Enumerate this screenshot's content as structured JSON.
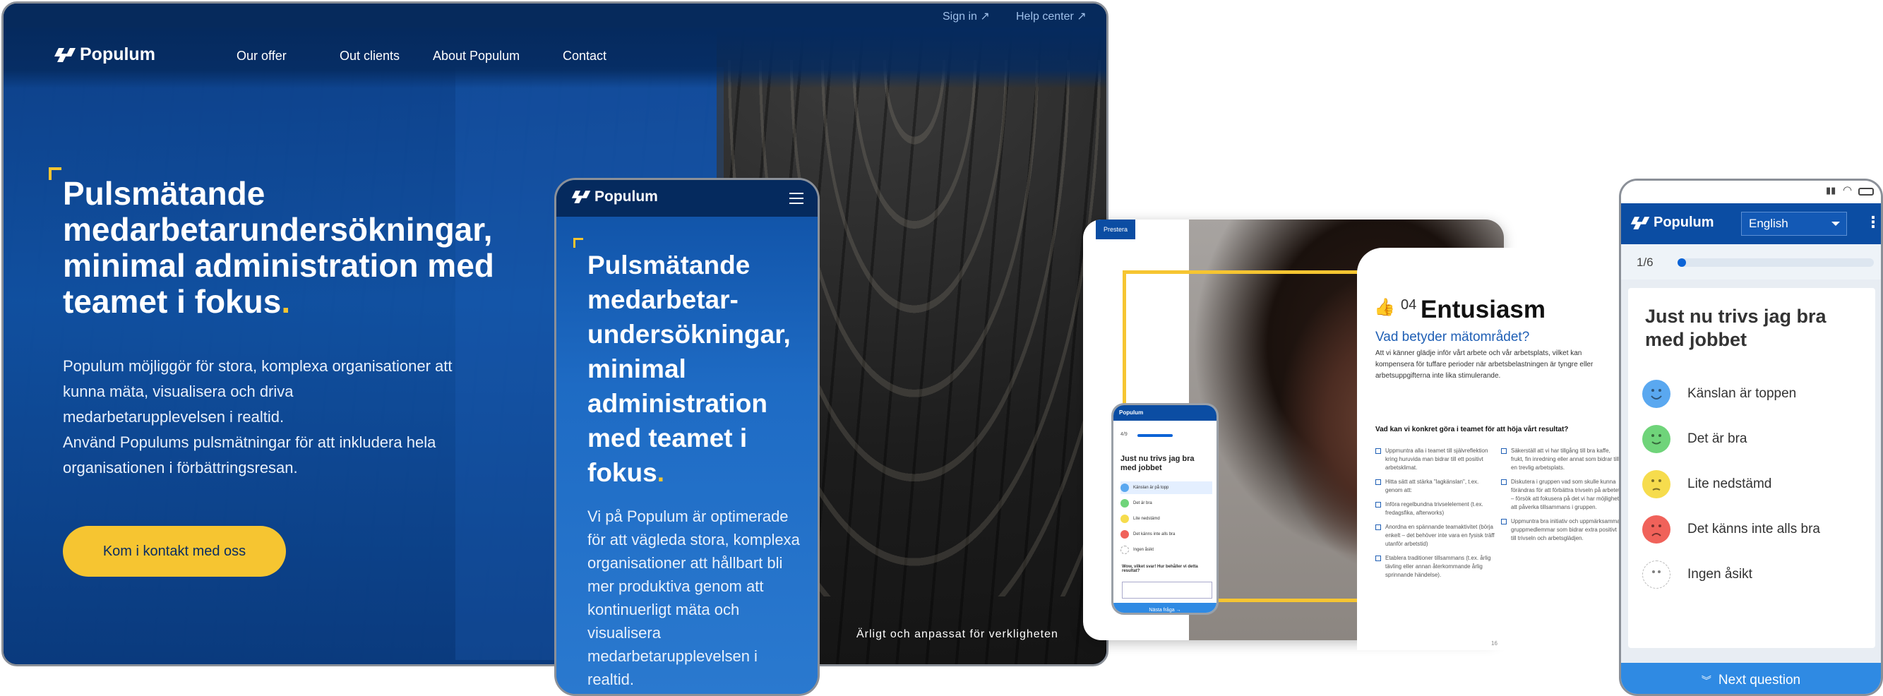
{
  "desktop": {
    "top_links": [
      "Sign in ↗",
      "Help center ↗"
    ],
    "brand": "Populum",
    "nav": [
      "Our offer",
      "Out clients",
      "About Populum",
      "Contact"
    ],
    "headline": "Pulsmätande medarbetarundersökningar, minimal administration med teamet i fokus",
    "headline_dot": ".",
    "para_1": "Populum möjliggör för stora, komplexa organisationer att kunna mäta, visualisera och driva medarbetarupplevelsen i realtid.",
    "para_2": "Använd Populums pulsmätningar för att inkludera hela organisationen i förbättringsresan.",
    "cta": "Kom i kontakt med oss",
    "caption": "Ärligt och anpassat för verkligheten"
  },
  "tablet": {
    "brand": "Populum",
    "headline": "Pulsmätande medarbetar-undersökningar, minimal administration med teamet i fokus",
    "headline_dot": ".",
    "para": "Vi på Populum är optimerade för att vägleda stora, komplexa organisationer att hållbart bli mer produktiva genom att kontinuerligt mäta och visualisera medarbetarupplevelsen i realtid."
  },
  "brochure": {
    "label": "Prestera",
    "mini": {
      "brand": "Populum",
      "progress": "4/9",
      "question": "Just nu trivs jag bra med jobbet",
      "options": [
        "Känslan är på topp",
        "Det är bra",
        "Lite nedstämd",
        "Det känns inte alls bra",
        "Ingen åsikt"
      ],
      "followup": "Wow, vilket svar! Hur behåller vi detta resultat?",
      "button": "Nästa fråga →"
    },
    "number": "04",
    "title": "Entusiasm",
    "subtitle": "Vad betyder mätområdet?",
    "body": "Att vi känner glädje inför vårt arbete och vår arbetsplats, vilket kan kompensera för tuffare perioder när arbetsbelastningen är tyngre eller arbetsuppgifterna inte lika stimulerande.",
    "section": "Vad kan vi konkret göra i teamet för att höja vårt resultat?",
    "col1": [
      "Uppmuntra alla i teamet till självreflektion kring huruvida man bidrar till ett positivt arbetsklimat.",
      "Hitta sätt att stärka \"lagkänslan\", t.ex. genom att:",
      "Införa regelbundna trivselelement (t.ex. fredagsfika, afterworks)",
      "Anordna en spännande teamaktivitet (börja enkelt – det behöver inte vara en fysisk träff utanför arbetstid)",
      "Etablera traditioner tillsammans (t.ex. årlig tävling eller annan återkommande årlig sprinnande händelse)."
    ],
    "col2": [
      "Säkerställ att vi har tillgång till bra kaffe, frukt, fin inredning eller annat som bidrar till en trevlig arbetsplats.",
      "Diskutera i gruppen vad som skulle kunna förändras för att förbättra trivseln på arbetet – försök att fokusera på det vi har möjlighet att påverka tillsammans i gruppen.",
      "Uppmuntra bra initiativ och uppmärksamma gruppmedlemmar som bidrar extra positivt till trivseln och arbetsglädjen."
    ],
    "page": "16"
  },
  "phone": {
    "brand": "Populum",
    "language": "English",
    "progress_text": "1/6",
    "progress_fraction": 0.167,
    "question": "Just nu trivs jag bra med jobbet",
    "options": [
      {
        "label": "Känslan är toppen",
        "color": "#5aa8f0"
      },
      {
        "label": "Det är bra",
        "color": "#6fd47a"
      },
      {
        "label": "Lite nedstämd",
        "color": "#f6dc4d"
      },
      {
        "label": "Det känns inte alls bra",
        "color": "#f0625a"
      },
      {
        "label": "Ingen åsikt",
        "color": "#ffffff"
      }
    ],
    "next": "Next question",
    "next_icon": "chevrons-down-icon"
  },
  "colors": {
    "brand_blue": "#0b4da3",
    "accent_yellow": "#f6c531",
    "navy": "#052a5e"
  }
}
